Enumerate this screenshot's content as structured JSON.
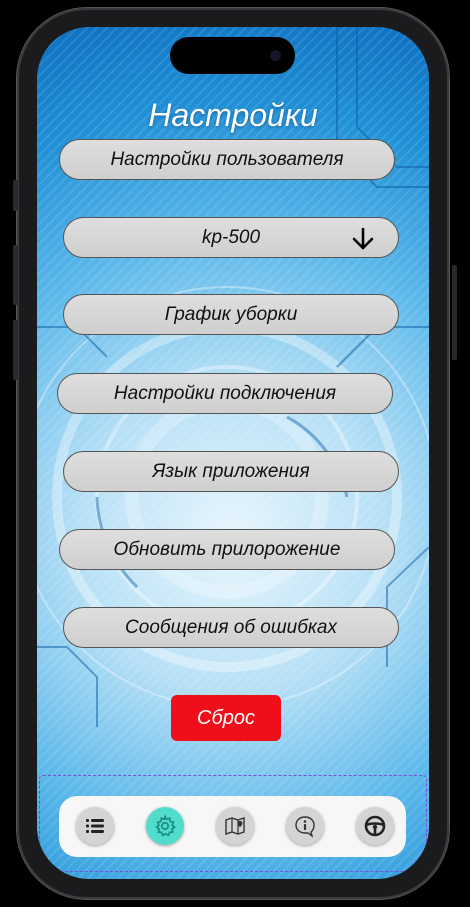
{
  "screen": {
    "title": "Настройки"
  },
  "menu": {
    "user_settings": "Настройки пользователя",
    "device_select": "kp-500",
    "cleaning_schedule": "График уборки",
    "connection_settings": "Настройки подключения",
    "app_language": "Язык приложения",
    "update_app": "Обновить прилорожение",
    "error_messages": "Сообщения об ошибках"
  },
  "reset_button": {
    "label": "Сброс",
    "color": "#ee0f1b"
  },
  "tabbar": {
    "tabs": [
      {
        "icon": "list-icon"
      },
      {
        "icon": "gear-icon",
        "active": true,
        "color": "#52dccc"
      },
      {
        "icon": "map-icon"
      },
      {
        "icon": "info-icon"
      },
      {
        "icon": "steering-wheel-icon"
      }
    ]
  }
}
